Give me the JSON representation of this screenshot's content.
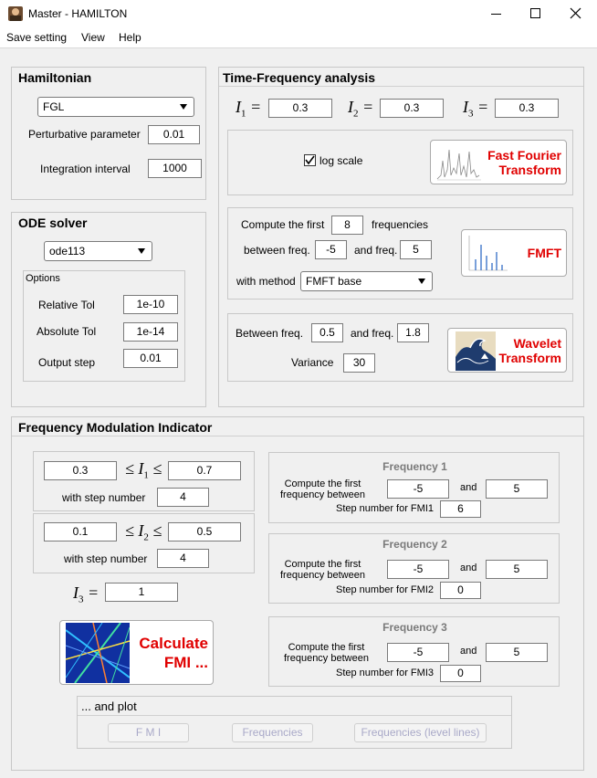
{
  "window": {
    "title": "Master - HAMILTON"
  },
  "menu": [
    "Save setting",
    "View",
    "Help"
  ],
  "hamiltonian": {
    "title": "Hamiltonian",
    "selected": "FGL",
    "perturbative_label": "Perturbative parameter",
    "perturbative_value": "0.01",
    "integration_label": "Integration interval",
    "integration_value": "1000"
  },
  "ode": {
    "title": "ODE solver",
    "selected": "ode113",
    "options_title": "Options",
    "rel_label": "Relative Tol",
    "rel_value": "1e-10",
    "abs_label": "Absolute Tol",
    "abs_value": "1e-14",
    "step_label": "Output step",
    "step_value": "0.01"
  },
  "tf": {
    "title": "Time-Frequency analysis",
    "I1_sym": "I",
    "I1_sub": "1",
    "I1_value": "0.3",
    "I2_sym": "I",
    "I2_sub": "2",
    "I2_value": "0.3",
    "I3_sym": "I",
    "I3_sub": "3",
    "I3_value": "0.3",
    "eq": "=",
    "log_label": "log scale",
    "log_checked": true,
    "fft_line1": "Fast Fourier",
    "fft_line2": "Transform",
    "compute_label": "Compute the first",
    "compute_value": "8",
    "frequencies_label": "frequencies",
    "between_label": "between freq.",
    "between_value": "-5",
    "and_label": "and freq.",
    "and_value": "5",
    "method_label": "with method",
    "method_value": "FMFT base",
    "fmft_label": "FMFT",
    "wav_between_label": "Between freq.",
    "wav_between_value": "0.5",
    "wav_and_label": "and freq.",
    "wav_and_value": "1.8",
    "variance_label": "Variance",
    "variance_value": "30",
    "wavelet_line1": "Wavelet",
    "wavelet_line2": "Transform"
  },
  "fmi": {
    "title": "Frequency Modulation Indicator",
    "i1_min": "0.3",
    "i1_max": "0.7",
    "i1_step_label": "with step number",
    "i1_step": "4",
    "i2_min": "0.1",
    "i2_max": "0.5",
    "i2_step_label": "with step number",
    "i2_step": "4",
    "leq": "≤",
    "i3_value": "1",
    "calc_line1": "Calculate",
    "calc_line2": "FMI ...",
    "freq": [
      {
        "title": "Frequency 1",
        "compute_line1": "Compute the first",
        "compute_line2": "frequency between",
        "from": "-5",
        "and": "and",
        "to": "5",
        "step_label": "Step number for FMI1",
        "step": "6"
      },
      {
        "title": "Frequency 2",
        "compute_line1": "Compute the first",
        "compute_line2": "frequency between",
        "from": "-5",
        "and": "and",
        "to": "5",
        "step_label": "Step number for FMI2",
        "step": "0"
      },
      {
        "title": "Frequency 3",
        "compute_line1": "Compute the first",
        "compute_line2": "frequency between",
        "from": "-5",
        "and": "and",
        "to": "5",
        "step_label": "Step number for FMI3",
        "step": "0"
      }
    ],
    "plot_title": "... and plot",
    "plot_buttons": [
      "F M I",
      "Frequencies",
      "Frequencies (level lines)"
    ]
  },
  "colors": {
    "accent_red": "#e00000",
    "panel_bg": "#f0f0f0",
    "disabled_text": "#a9a9c8"
  }
}
